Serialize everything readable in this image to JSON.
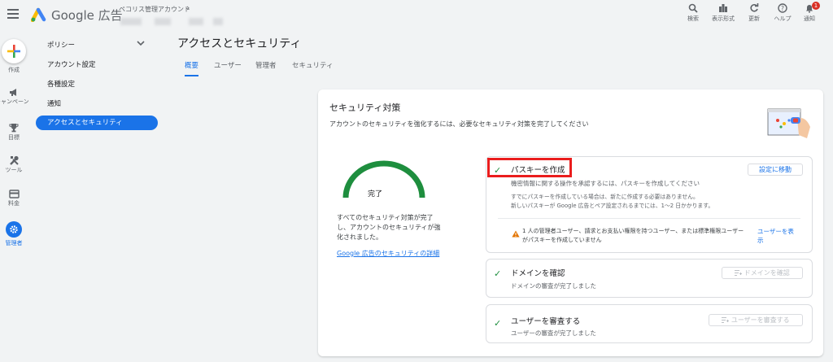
{
  "header": {
    "product_name": "Google 広告",
    "account_name": "ペコリス管理アカウント",
    "account_chevron": "›",
    "tools": [
      {
        "label": "検索",
        "icon": "search-icon"
      },
      {
        "label": "表示形式",
        "icon": "appearance-icon"
      },
      {
        "label": "更新",
        "icon": "refresh-icon"
      },
      {
        "label": "ヘルプ",
        "icon": "help-icon"
      },
      {
        "label": "通知",
        "icon": "notifications-icon",
        "badge": "1"
      }
    ]
  },
  "rail": {
    "items": [
      {
        "label": "作成",
        "icon": "create-plus-icon"
      },
      {
        "label": "キャンペーン",
        "icon": "campaign-megaphone-icon"
      },
      {
        "label": "目標",
        "icon": "goals-trophy-icon"
      },
      {
        "label": "ツール",
        "icon": "tools-icon"
      },
      {
        "label": "料金",
        "icon": "billing-card-icon"
      },
      {
        "label": "管理者",
        "icon": "admin-gear-icon",
        "active": true
      }
    ]
  },
  "sidebar": {
    "items": [
      {
        "label": "ポリシー"
      },
      {
        "label": "アカウント設定"
      },
      {
        "label": "各種設定"
      },
      {
        "label": "通知"
      },
      {
        "label": "アクセスとセキュリティ",
        "active": true
      }
    ]
  },
  "page": {
    "title": "アクセスとセキュリティ",
    "tabs": [
      {
        "label": "概要",
        "active": true
      },
      {
        "label": "ユーザー"
      },
      {
        "label": "管理者"
      },
      {
        "label": "セキュリティ"
      }
    ]
  },
  "security": {
    "title": "セキュリティ対策",
    "subtitle": "アカウントのセキュリティを強化するには、必要なセキュリティ対策を完了してください",
    "gauge_label": "完了",
    "gauge_progress": 1.0,
    "summary_line1": "すべてのセキュリティ対策が完了",
    "summary_line2": "し、アカウントのセキュリティが強",
    "summary_line3": "化されました。",
    "detail_link": "Google 広告のセキュリティの詳細",
    "tasks": [
      {
        "title": "パスキーを作成",
        "description": "機密情報に関する操作を承認するには、パスキーを作成してください",
        "note_line1": "すでにパスキーを作成している場合は、新たに作成する必要はありません。",
        "note_line2": "新しいパスキーが Google 広告とペア設定されるまでには、1〜2 日かかります。",
        "button": "設定に移動",
        "warning_line1": "1 人の管理者ユーザー、請求とお支払い権限を持つユーザー、または標準権限ユーザー",
        "warning_line2": "がパスキーを作成していません",
        "warning_link": "ユーザーを表示"
      },
      {
        "title": "ドメインを確認",
        "description": "ドメインの審査が完了しました",
        "button": "ドメインを確認"
      },
      {
        "title": "ユーザーを審査する",
        "description": "ユーザーの審査が完了しました",
        "button": "ユーザーを審査する"
      }
    ]
  },
  "colors": {
    "accent": "#1a73e8",
    "success": "#1e8e3e",
    "highlight": "#ea1d1d",
    "warning": "#e37400"
  }
}
